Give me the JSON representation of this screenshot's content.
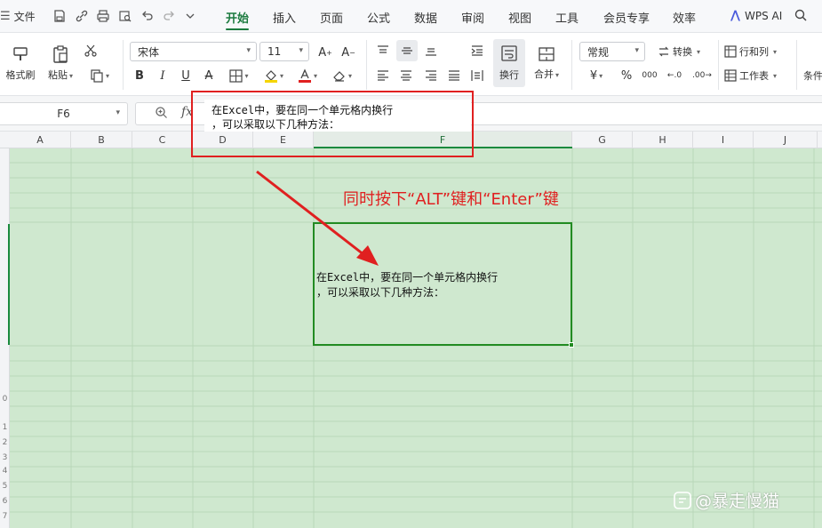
{
  "menubar": {
    "file_label": "文件",
    "tabs": [
      {
        "label": "开始",
        "active": true
      },
      {
        "label": "插入"
      },
      {
        "label": "页面"
      },
      {
        "label": "公式"
      },
      {
        "label": "数据"
      },
      {
        "label": "审阅"
      },
      {
        "label": "视图"
      },
      {
        "label": "工具"
      },
      {
        "label": "会员专享"
      },
      {
        "label": "效率"
      }
    ],
    "wps_ai": "WPS AI",
    "accent_color": "#1b7a3e"
  },
  "ribbon": {
    "format_painter": "格式刷",
    "paste": "粘贴",
    "font_name": "宋体",
    "font_size": "11",
    "wrap_text": "换行",
    "merge": "合并",
    "number_format": "常规",
    "convert": "转换",
    "rows_cols": "行和列",
    "worksheet": "工作表",
    "conditional": "条件",
    "bold": "B",
    "italic": "I",
    "underline": "U",
    "strike": "A",
    "currency": "¥",
    "percent": "%",
    "thousands": "000",
    "inc_decimal": "←.0",
    "dec_decimal": ".00→"
  },
  "formulabar": {
    "name_box": "F6",
    "fx": "fx",
    "content_line1": "在Excel中，要在同一个单元格内换行",
    "content_line2": "，可以采取以下几种方法："
  },
  "grid": {
    "columns": [
      "A",
      "B",
      "C",
      "D",
      "E",
      "F",
      "G",
      "H",
      "I",
      "J"
    ],
    "selected_column": "F",
    "active_cell": "F6",
    "cell_line1": "在Excel中，要在同一个单元格内换行",
    "cell_line2": "，可以采取以下几种方法：",
    "row_numbers": [
      "0",
      "1",
      "2",
      "3",
      "4",
      "5",
      "6",
      "7"
    ],
    "sheet_color": "#cfe8cf"
  },
  "annotation": {
    "tip": "同时按下“ALT”键和“Enter”键",
    "color": "#e02020"
  },
  "watermark": "@暴走慢猫"
}
